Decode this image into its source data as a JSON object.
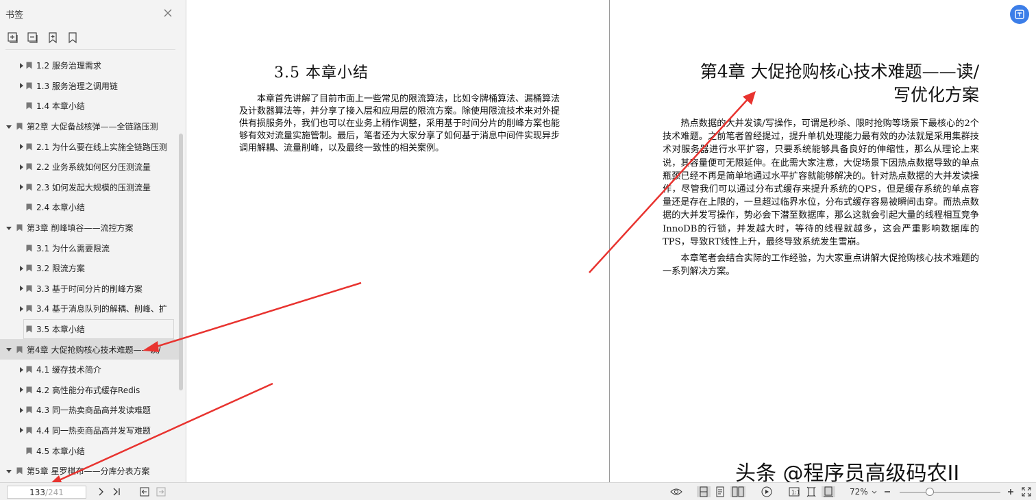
{
  "sidebar": {
    "title": "书签",
    "items": [
      {
        "label": "1.2 服务治理需求",
        "level": 1,
        "arrow": true
      },
      {
        "label": "1.3 服务治理之调用链",
        "level": 1,
        "arrow": true
      },
      {
        "label": "1.4 本章小结",
        "level": 1,
        "arrow": false
      },
      {
        "label": "第2章 大促备战核弹——全链路压测",
        "level": 0,
        "arrow": true
      },
      {
        "label": "2.1 为什么要在线上实施全链路压测",
        "level": 1,
        "arrow": true
      },
      {
        "label": "2.2 业务系统如何区分压测流量",
        "level": 1,
        "arrow": true
      },
      {
        "label": "2.3 如何发起大规模的压测流量",
        "level": 1,
        "arrow": true
      },
      {
        "label": "2.4 本章小结",
        "level": 1,
        "arrow": false
      },
      {
        "label": "第3章 削峰填谷——流控方案",
        "level": 0,
        "arrow": true
      },
      {
        "label": "3.1 为什么需要限流",
        "level": 1,
        "arrow": false
      },
      {
        "label": "3.2 限流方案",
        "level": 1,
        "arrow": true
      },
      {
        "label": "3.3 基于时间分片的削峰方案",
        "level": 1,
        "arrow": true
      },
      {
        "label": "3.4 基于消息队列的解耦、削峰、扩",
        "level": 1,
        "arrow": true
      },
      {
        "label": "3.5 本章小结",
        "level": 1,
        "arrow": false,
        "outlined": true
      },
      {
        "label": "第4章 大促抢购核心技术难题——读/",
        "level": 0,
        "arrow": true,
        "selected": true
      },
      {
        "label": "4.1 缓存技术简介",
        "level": 1,
        "arrow": true
      },
      {
        "label": "4.2 高性能分布式缓存Redis",
        "level": 1,
        "arrow": true
      },
      {
        "label": "4.3 同一热卖商品高并发读难题",
        "level": 1,
        "arrow": true
      },
      {
        "label": "4.4 同一热卖商品高并发写难题",
        "level": 1,
        "arrow": true
      },
      {
        "label": "4.5 本章小结",
        "level": 1,
        "arrow": false
      },
      {
        "label": "第5章 星罗棋布——分库分表方案",
        "level": 0,
        "arrow": true
      }
    ]
  },
  "document": {
    "left_page": {
      "title": "3.5  本章小结",
      "paragraph": "本章首先讲解了目前市面上一些常见的限流算法，比如令牌桶算法、漏桶算法及计数器算法等，并分享了接入层和应用层的限流方案。除使用限流技术来对外提供有损服务外，我们也可以在业务上稍作调整，采用基于时间分片的削峰方案也能够有效对流量实施管制。最后，笔者还为大家分享了如何基于消息中间件实现异步调用解耦、流量削峰，以及最终一致性的相关案例。"
    },
    "right_page": {
      "title_line1": "第4章  大促抢购核心技术难题——读/",
      "title_line2": "写优化方案",
      "paragraph1": "热点数据的大并发读/写操作，可谓是秒杀、限时抢购等场景下最核心的2个技术难题。之前笔者曾经提过，提升单机处理能力最有效的办法就是采用集群技术对服务器进行水平扩容，只要系统能够具备良好的伸缩性，那么从理论上来说，其容量便可无限延伸。在此需大家注意，大促场景下因热点数据导致的单点瓶颈已经不再是简单地通过水平扩容就能够解决的。针对热点数据的大并发读操作，尽管我们可以通过分布式缓存来提升系统的QPS，但是缓存系统的单点容量还是存在上限的，一旦超过临界水位，分布式缓存容易被瞬间击穿。而热点数据的大并发写操作，势必会下潜至数据库，那么这就会引起大量的线程相互竞争InnoDB的行锁，并发越大时，等待的线程就越多，这会严重影响数据库的TPS，导致RT线性上升，最终导致系统发生雪崩。",
      "paragraph2": "本章笔者会结合实际的工作经验，为大家重点讲解大促抢购核心技术难题的一系列解决方案。"
    },
    "watermark": "头条 @程序员高级码农II"
  },
  "statusbar": {
    "current_page": "133",
    "total_pages": "/241",
    "zoom": "72%",
    "zoom_level": 0.3
  },
  "colors": {
    "accent": "#3c7ee8",
    "arrow": "#e8332f",
    "sidebar_bg": "#f3f3f3",
    "selected_bg": "#dcdcdc"
  }
}
